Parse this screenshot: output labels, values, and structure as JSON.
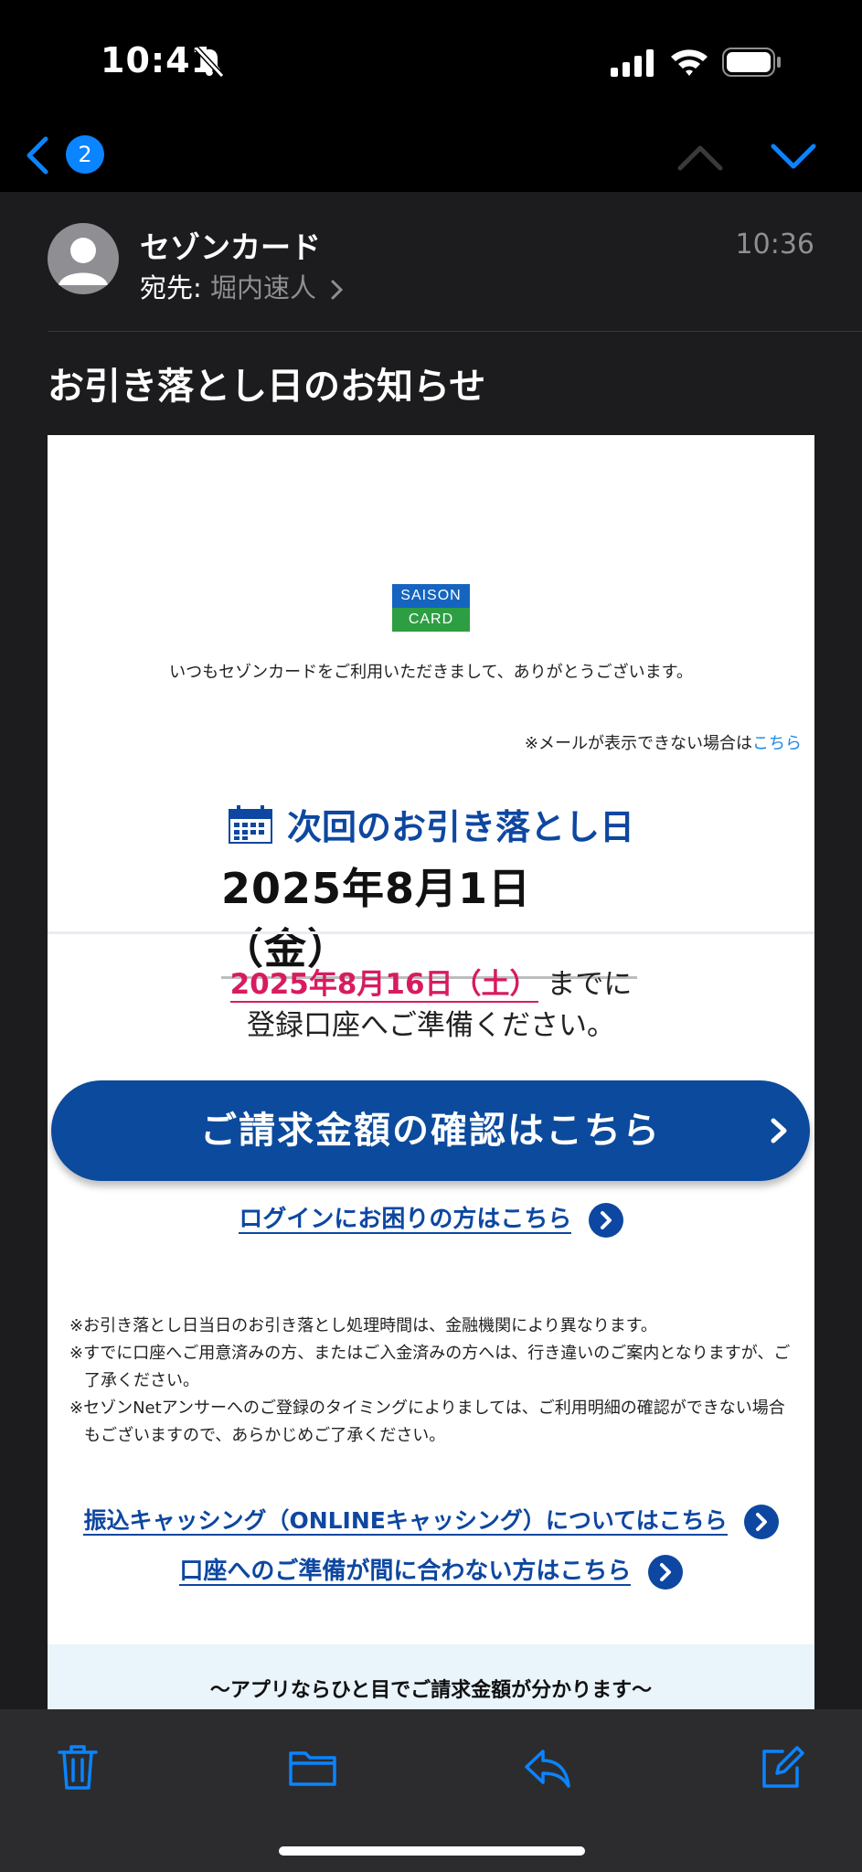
{
  "status_bar": {
    "time": "10:41"
  },
  "nav": {
    "unread_count": "2"
  },
  "message": {
    "sender": "セゾンカード",
    "time": "10:36",
    "to_label": "宛先:",
    "to_name": "堀内速人",
    "subject": "お引き落とし日のお知らせ"
  },
  "email": {
    "logo_top": "SAISON",
    "logo_bottom": "CARD",
    "greeting": "いつもセゾンカードをご利用いただきまして、ありがとうございます。",
    "notice_text": "※メールが表示できない場合は",
    "notice_link": "こちら",
    "next_title": "次回のお引き落とし日",
    "due_date": "2025年8月1日（金）",
    "deadline_date": "2025年8月16日（土）",
    "deadline_suffix": "までに",
    "prepare_text": "登録口座へご準備ください。",
    "billing_button": "ご請求金額の確認はこちら",
    "login_link": "ログインにお困りの方はこちら",
    "notes": [
      "※お引き落とし日当日のお引き落とし処理時間は、金融機関により異なります。",
      "※すでに口座へご用意済みの方、またはご入金済みの方へは、行き違いのご案内となりますが、ご了承ください。",
      "※セゾンNetアンサーへのご登録のタイミングによりましては、ご利用明細の確認ができない場合もございますので、あらかじめご了承ください。"
    ],
    "cash_link": "振込キャッシング（ONLINEキャッシング）についてはこちら",
    "prep_link": "口座へのご準備が間に合わない方はこちら",
    "app_text": "〜アプリならひと目でご請求金額が分かります〜"
  },
  "colors": {
    "accent": "#0a84ff",
    "brand_blue": "#0b4a9c",
    "deadline_red": "#d81b60"
  },
  "icons": [
    "back-chevron-icon",
    "up-chevron-icon",
    "down-chevron-icon",
    "calendar-icon",
    "trash-icon",
    "folder-icon",
    "reply-icon",
    "compose-icon"
  ]
}
